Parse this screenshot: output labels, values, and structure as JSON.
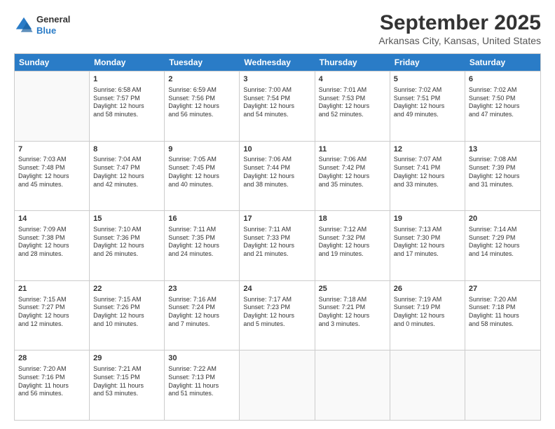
{
  "logo": {
    "general": "General",
    "blue": "Blue"
  },
  "title": "September 2025",
  "subtitle": "Arkansas City, Kansas, United States",
  "days": [
    "Sunday",
    "Monday",
    "Tuesday",
    "Wednesday",
    "Thursday",
    "Friday",
    "Saturday"
  ],
  "rows": [
    [
      {
        "num": "",
        "info": ""
      },
      {
        "num": "1",
        "info": "Sunrise: 6:58 AM\nSunset: 7:57 PM\nDaylight: 12 hours\nand 58 minutes."
      },
      {
        "num": "2",
        "info": "Sunrise: 6:59 AM\nSunset: 7:56 PM\nDaylight: 12 hours\nand 56 minutes."
      },
      {
        "num": "3",
        "info": "Sunrise: 7:00 AM\nSunset: 7:54 PM\nDaylight: 12 hours\nand 54 minutes."
      },
      {
        "num": "4",
        "info": "Sunrise: 7:01 AM\nSunset: 7:53 PM\nDaylight: 12 hours\nand 52 minutes."
      },
      {
        "num": "5",
        "info": "Sunrise: 7:02 AM\nSunset: 7:51 PM\nDaylight: 12 hours\nand 49 minutes."
      },
      {
        "num": "6",
        "info": "Sunrise: 7:02 AM\nSunset: 7:50 PM\nDaylight: 12 hours\nand 47 minutes."
      }
    ],
    [
      {
        "num": "7",
        "info": "Sunrise: 7:03 AM\nSunset: 7:48 PM\nDaylight: 12 hours\nand 45 minutes."
      },
      {
        "num": "8",
        "info": "Sunrise: 7:04 AM\nSunset: 7:47 PM\nDaylight: 12 hours\nand 42 minutes."
      },
      {
        "num": "9",
        "info": "Sunrise: 7:05 AM\nSunset: 7:45 PM\nDaylight: 12 hours\nand 40 minutes."
      },
      {
        "num": "10",
        "info": "Sunrise: 7:06 AM\nSunset: 7:44 PM\nDaylight: 12 hours\nand 38 minutes."
      },
      {
        "num": "11",
        "info": "Sunrise: 7:06 AM\nSunset: 7:42 PM\nDaylight: 12 hours\nand 35 minutes."
      },
      {
        "num": "12",
        "info": "Sunrise: 7:07 AM\nSunset: 7:41 PM\nDaylight: 12 hours\nand 33 minutes."
      },
      {
        "num": "13",
        "info": "Sunrise: 7:08 AM\nSunset: 7:39 PM\nDaylight: 12 hours\nand 31 minutes."
      }
    ],
    [
      {
        "num": "14",
        "info": "Sunrise: 7:09 AM\nSunset: 7:38 PM\nDaylight: 12 hours\nand 28 minutes."
      },
      {
        "num": "15",
        "info": "Sunrise: 7:10 AM\nSunset: 7:36 PM\nDaylight: 12 hours\nand 26 minutes."
      },
      {
        "num": "16",
        "info": "Sunrise: 7:11 AM\nSunset: 7:35 PM\nDaylight: 12 hours\nand 24 minutes."
      },
      {
        "num": "17",
        "info": "Sunrise: 7:11 AM\nSunset: 7:33 PM\nDaylight: 12 hours\nand 21 minutes."
      },
      {
        "num": "18",
        "info": "Sunrise: 7:12 AM\nSunset: 7:32 PM\nDaylight: 12 hours\nand 19 minutes."
      },
      {
        "num": "19",
        "info": "Sunrise: 7:13 AM\nSunset: 7:30 PM\nDaylight: 12 hours\nand 17 minutes."
      },
      {
        "num": "20",
        "info": "Sunrise: 7:14 AM\nSunset: 7:29 PM\nDaylight: 12 hours\nand 14 minutes."
      }
    ],
    [
      {
        "num": "21",
        "info": "Sunrise: 7:15 AM\nSunset: 7:27 PM\nDaylight: 12 hours\nand 12 minutes."
      },
      {
        "num": "22",
        "info": "Sunrise: 7:15 AM\nSunset: 7:26 PM\nDaylight: 12 hours\nand 10 minutes."
      },
      {
        "num": "23",
        "info": "Sunrise: 7:16 AM\nSunset: 7:24 PM\nDaylight: 12 hours\nand 7 minutes."
      },
      {
        "num": "24",
        "info": "Sunrise: 7:17 AM\nSunset: 7:23 PM\nDaylight: 12 hours\nand 5 minutes."
      },
      {
        "num": "25",
        "info": "Sunrise: 7:18 AM\nSunset: 7:21 PM\nDaylight: 12 hours\nand 3 minutes."
      },
      {
        "num": "26",
        "info": "Sunrise: 7:19 AM\nSunset: 7:19 PM\nDaylight: 12 hours\nand 0 minutes."
      },
      {
        "num": "27",
        "info": "Sunrise: 7:20 AM\nSunset: 7:18 PM\nDaylight: 11 hours\nand 58 minutes."
      }
    ],
    [
      {
        "num": "28",
        "info": "Sunrise: 7:20 AM\nSunset: 7:16 PM\nDaylight: 11 hours\nand 56 minutes."
      },
      {
        "num": "29",
        "info": "Sunrise: 7:21 AM\nSunset: 7:15 PM\nDaylight: 11 hours\nand 53 minutes."
      },
      {
        "num": "30",
        "info": "Sunrise: 7:22 AM\nSunset: 7:13 PM\nDaylight: 11 hours\nand 51 minutes."
      },
      {
        "num": "",
        "info": ""
      },
      {
        "num": "",
        "info": ""
      },
      {
        "num": "",
        "info": ""
      },
      {
        "num": "",
        "info": ""
      }
    ]
  ]
}
